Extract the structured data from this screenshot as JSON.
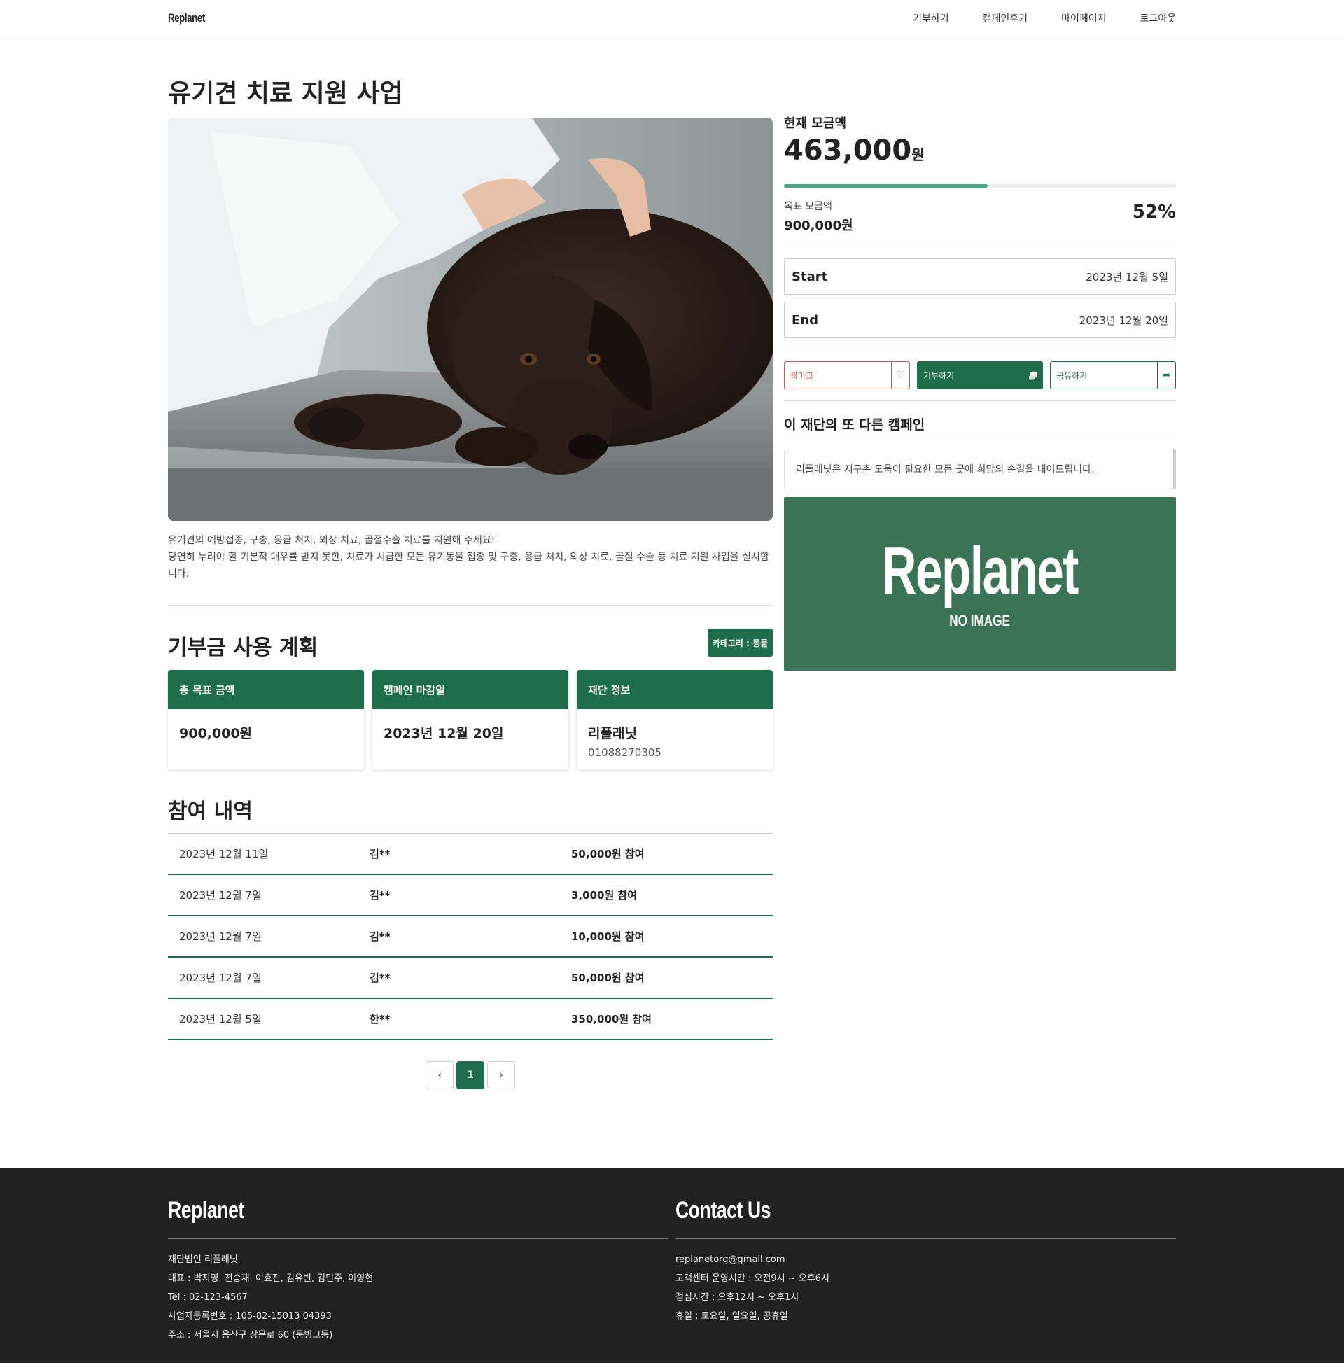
{
  "header": {
    "brand": "Replanet",
    "nav": [
      "기부하기",
      "캠페인후기",
      "마이페이지",
      "로그아웃"
    ]
  },
  "campaign": {
    "title": "유기견 치료 지원 사업",
    "description_line1": "유기견의 예방접종, 구충, 응급 처치, 외상 치료, 골절수술 치료를 지원해 주세요!",
    "description_line2": "당연히 누려야 할 기본적 대우를 받지 못한, 치료가 시급한 모든 유기동물 접종 및 구충, 응급 처치, 외상 치료, 골절 수술 등 치료 지원 사업을 실시합니다."
  },
  "plan": {
    "title": "기부금 사용 계획",
    "category": "카테고리 : 동물",
    "cards": [
      {
        "head": "총 목표 금액",
        "value": "900,000원",
        "sub": ""
      },
      {
        "head": "캠페인 마감일",
        "value": "2023년 12월 20일",
        "sub": ""
      },
      {
        "head": "재단 정보",
        "value": "리플래닛",
        "sub": "01088270305"
      }
    ]
  },
  "history": {
    "title": "참여 내역",
    "rows": [
      {
        "date": "2023년 12월 11일",
        "name": "김**",
        "amount": "50,000원 참여"
      },
      {
        "date": "2023년 12월 7일",
        "name": "김**",
        "amount": "3,000원 참여"
      },
      {
        "date": "2023년 12월 7일",
        "name": "김**",
        "amount": "10,000원 참여"
      },
      {
        "date": "2023년 12월 7일",
        "name": "김**",
        "amount": "50,000원 참여"
      },
      {
        "date": "2023년 12월 5일",
        "name": "한**",
        "amount": "350,000원 참여"
      }
    ],
    "pager": {
      "prev": "‹",
      "current": "1",
      "next": "›"
    }
  },
  "funding": {
    "current_label": "현재 모금액",
    "current_amount": "463,000",
    "unit": "원",
    "progress_percent": 52,
    "goal_label": "목표 모금액",
    "goal_amount": "900,000원",
    "percent_text": "52%",
    "start_label": "Start",
    "start_date": "2023년 12월 5일",
    "end_label": "End",
    "end_date": "2023년 12월 20일"
  },
  "actions": {
    "bookmark": "북마크",
    "donate": "기부하기",
    "share": "공유하기"
  },
  "other": {
    "title": "이 재단의 또 다른 캠페인",
    "text": "리플래닛은 지구촌 도움이 필요한 모든 곳에 희망의 손길을 내어드립니다.",
    "placeholder_brand": "Replanet",
    "placeholder_text": "NO IMAGE"
  },
  "footer": {
    "left_title": "Replanet",
    "left_lines": [
      "재단법인 리플래닛",
      "대표 : 박지영, 전승재, 이효진, 김유빈, 김민주, 이영현",
      "Tel : 02-123-4567",
      "사업자등록번호 : 105-82-15013 04393",
      "주소 : 서울시 용산구 장문로 60 (동빙고동)"
    ],
    "right_title": "Contact Us",
    "right_lines": [
      "replanetorg@gmail.com",
      "고객센터 운영시간 : 오전9시 ~ 오후6시",
      "점심시간 : 오후12시 ~ 오후1시",
      "휴일 : 토요일, 일요일, 공휴일"
    ]
  },
  "colors": {
    "primary": "#1e6e4e",
    "accent": "#4ca785",
    "danger": "#d9534f",
    "footer_bg": "#212121"
  }
}
